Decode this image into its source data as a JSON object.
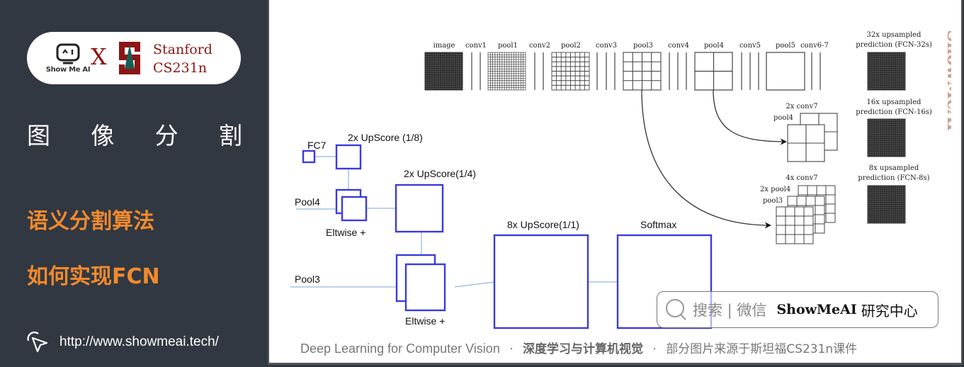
{
  "sidebar": {
    "logo": {
      "showmeai_label": "Show Me AI",
      "cross": "X",
      "partner_line1": "Stanford",
      "partner_line2": "CS231n",
      "partner_color": "#8c1515"
    },
    "section_title_chars": [
      "图",
      "像",
      "分",
      "割"
    ],
    "topic_line1": "语义分割算法",
    "topic_line2": "如何实现FCN",
    "topic_color": "#f18a2e",
    "website": "http://www.showmeai.tech/",
    "background": "#323841"
  },
  "diagram_top": {
    "stages": [
      "image",
      "conv1",
      "pool1",
      "conv2",
      "pool2",
      "conv3",
      "pool3",
      "conv4",
      "pool4",
      "conv5",
      "pool5",
      "conv6-7"
    ],
    "predictions": [
      {
        "line1": "32x upsampled",
        "line2": "prediction (FCN-32s)"
      },
      {
        "line1": "16x upsampled",
        "line2": "prediction (FCN-16s)"
      },
      {
        "line1": "8x upsampled",
        "line2": "prediction (FCN-8s)"
      }
    ],
    "fusion16": {
      "title": "2x conv7",
      "sub": "pool4"
    },
    "fusion8": {
      "title": "4x conv7",
      "sub1": "2x pool4",
      "sub2": "pool3"
    }
  },
  "diagram_bottom": {
    "fc7": "FC7",
    "up1": "2x UpScore (1/8)",
    "pool4": "Pool4",
    "eltwise1": "Eltwise +",
    "up2": "2x UpScore(1/4)",
    "pool3": "Pool3",
    "eltwise2": "Eltwise +",
    "up3": "8x UpScore(1/1)",
    "softmax": "Softmax",
    "box_color": "#3b3bdb"
  },
  "search": {
    "placeholder": "搜索 | 微信",
    "brand": "ShowMeAI",
    "brand_cn": "研究中心"
  },
  "footer": {
    "en": "Deep Learning for Computer Vision",
    "sep": "·",
    "cn_bold": "深度学习与计算机视觉",
    "note": "部分图片来源于斯坦福CS231n课件"
  },
  "watermark": "ShowMeAI"
}
